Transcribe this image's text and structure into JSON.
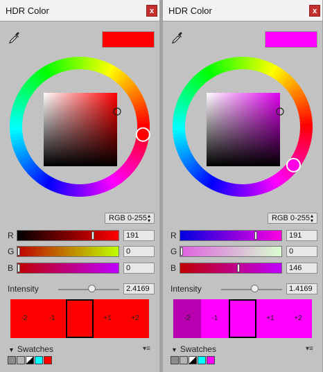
{
  "panels": [
    {
      "title": "HDR Color",
      "close": "x",
      "preview_color": "#ff0000",
      "wheel_marker_color": "#ff0000",
      "square_hue_color": "#ff0000",
      "mode": "RGB 0-255",
      "mode_icon": "up-down-arrows-icon",
      "channels": [
        {
          "label": "R",
          "value": "191",
          "level": 0.749,
          "gradient": "linear-gradient(to right, #000000, #ff0000)"
        },
        {
          "label": "G",
          "value": "0",
          "level": 0.0,
          "gradient": "linear-gradient(to right, #bf0000, #bfff00)"
        },
        {
          "label": "B",
          "value": "0",
          "level": 0.0,
          "gradient": "linear-gradient(to right, #bf0000, #bf00ff)"
        }
      ],
      "intensity_label": "Intensity",
      "intensity_value": "2.4169",
      "intensity_level": 0.54,
      "stops": [
        {
          "label": "-2",
          "color": "#ff0000"
        },
        {
          "label": "-1",
          "color": "#ff0000"
        },
        {
          "label": "",
          "color": "#ff0000"
        },
        {
          "label": "+1",
          "color": "#ff0000"
        },
        {
          "label": "+2",
          "color": "#ff0000"
        }
      ],
      "swatches_label": "Swatches",
      "swatches": [
        "#8c8c8c",
        "#b4b4b4",
        "split",
        "#00ffff",
        "#ff0000"
      ]
    },
    {
      "title": "HDR Color",
      "close": "x",
      "preview_color": "#ff00ff",
      "wheel_marker_color": "#ff00e6",
      "square_hue_color": "#e000f0",
      "mode": "RGB 0-255",
      "mode_icon": "up-down-arrows-icon",
      "channels": [
        {
          "label": "R",
          "value": "191",
          "level": 0.749,
          "gradient": "linear-gradient(to right, #0000e0, #ff00e0)"
        },
        {
          "label": "G",
          "value": "0",
          "level": 0.0,
          "gradient": "linear-gradient(to right, #e060e0, #d8ffd0)"
        },
        {
          "label": "B",
          "value": "146",
          "level": 0.573,
          "gradient": "linear-gradient(to right, #bf0000, #bf00ff)"
        }
      ],
      "intensity_label": "Intensity",
      "intensity_value": "1.4169",
      "intensity_level": 0.55,
      "stops": [
        {
          "label": "-2",
          "color": "#b800b0"
        },
        {
          "label": "-1",
          "color": "#ff00ff"
        },
        {
          "label": "",
          "color": "#ff00ff"
        },
        {
          "label": "+1",
          "color": "#ff00ff"
        },
        {
          "label": "+2",
          "color": "#ff00ff"
        }
      ],
      "swatches_label": "Swatches",
      "swatches": [
        "#8c8c8c",
        "#b4b4b4",
        "split",
        "#00ffff",
        "#ff00ff"
      ]
    }
  ]
}
